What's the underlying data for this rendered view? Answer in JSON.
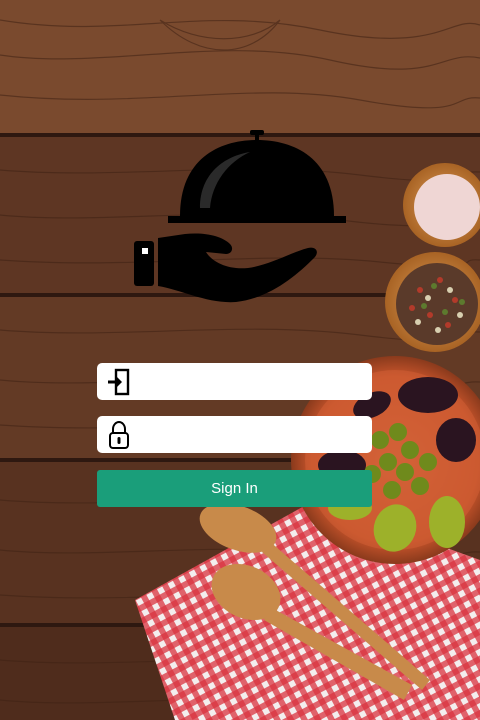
{
  "login": {
    "username_value": "",
    "username_placeholder": "",
    "password_value": "",
    "password_placeholder": "",
    "sign_in_label": "Sign In"
  },
  "icons": {
    "logo": "serving-cloche-hand-icon",
    "username": "login-icon",
    "password": "lock-icon"
  },
  "colors": {
    "button": "#1a9e7a",
    "button_text": "#ffffff",
    "field_bg": "#ffffff",
    "logo": "#000000"
  }
}
